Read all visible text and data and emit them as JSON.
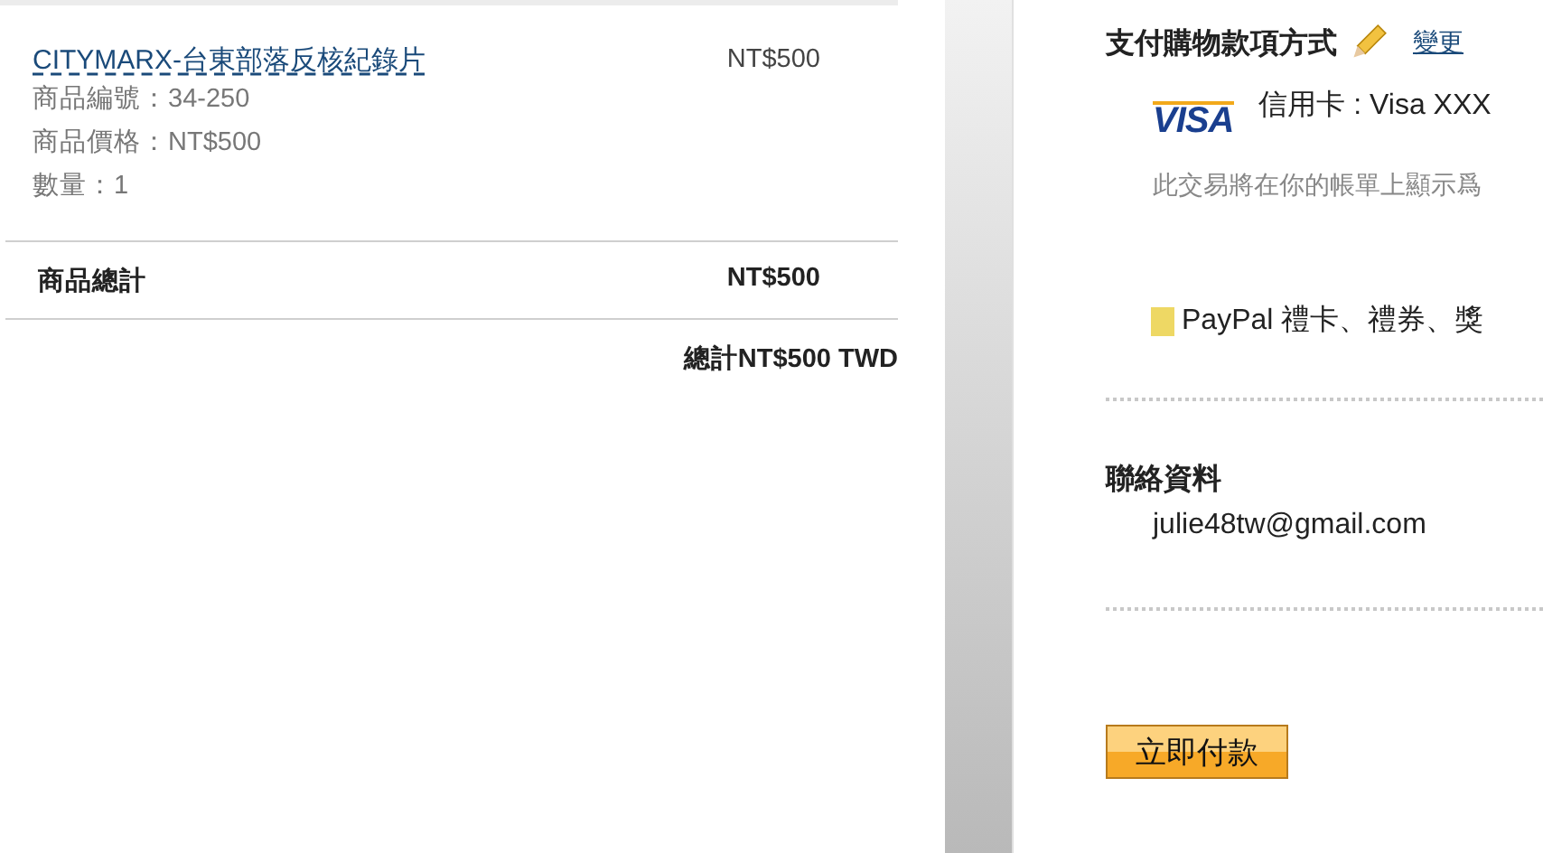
{
  "cart": {
    "item": {
      "name": "CITYMARX-台東部落反核紀錄片",
      "price": "NT$500",
      "details": [
        "商品編號：34-250",
        "商品價格：NT$500",
        "數量：1"
      ]
    },
    "subtotal": {
      "label": "商品總計",
      "value": "NT$500"
    },
    "total": "總計NT$500 TWD"
  },
  "payment": {
    "title": "支付購物款項方式",
    "change_link": "變更",
    "card_logo": "VISA",
    "card": "信用卡 : Visa XXX",
    "statement_note": "此交易將在你的帳單上顯示爲",
    "gift_option": "PayPal 禮卡、禮券、獎"
  },
  "contact": {
    "title": "聯絡資料",
    "email": "julie48tw@gmail.com"
  },
  "pay_button": "立即付款"
}
